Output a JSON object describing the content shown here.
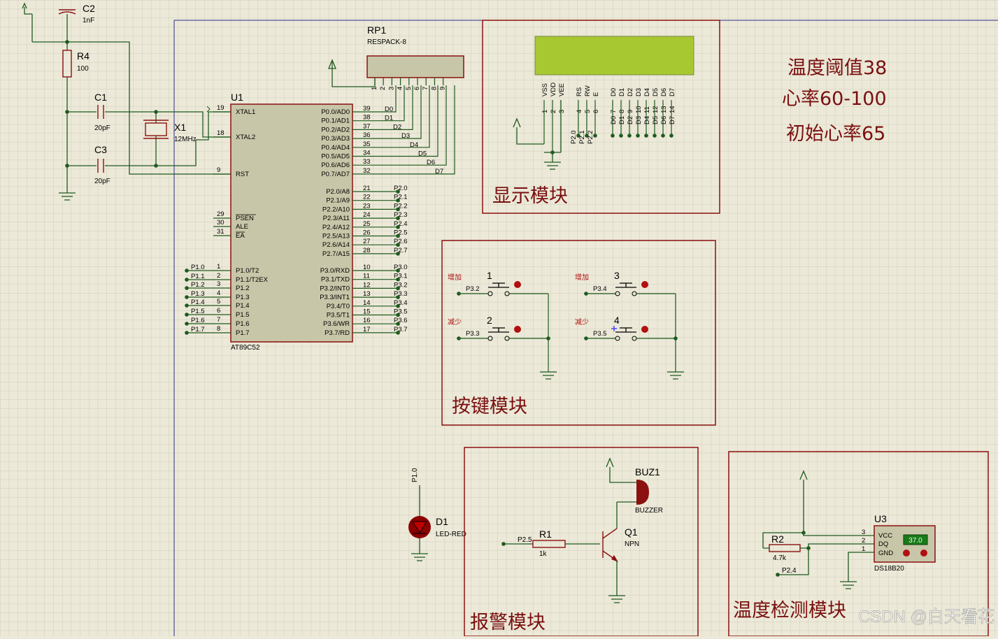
{
  "notes": {
    "threshold": "温度阈值38",
    "heart_range": "心率60-100",
    "initial_rate": "初始心率65"
  },
  "modules": {
    "display": "显示模块",
    "keys": "按键模块",
    "alarm": "报警模块",
    "temperature": "温度检测模块"
  },
  "mcu": {
    "ref": "U1",
    "part": "AT89C52",
    "left_pins": [
      {
        "num": "19",
        "label": "XTAL1"
      },
      {
        "num": "18",
        "label": "XTAL2"
      },
      {
        "num": "9",
        "label": "RST"
      },
      {
        "num": "29",
        "label": "PSEN"
      },
      {
        "num": "30",
        "label": "ALE"
      },
      {
        "num": "31",
        "label": "EA"
      },
      {
        "num": "1",
        "label": "P1.0/T2"
      },
      {
        "num": "2",
        "label": "P1.1/T2EX"
      },
      {
        "num": "3",
        "label": "P1.2"
      },
      {
        "num": "4",
        "label": "P1.3"
      },
      {
        "num": "5",
        "label": "P1.4"
      },
      {
        "num": "6",
        "label": "P1.5"
      },
      {
        "num": "7",
        "label": "P1.6"
      },
      {
        "num": "8",
        "label": "P1.7"
      }
    ],
    "p0": [
      {
        "num": "39",
        "label": "P0.0/AD0",
        "net": "D0"
      },
      {
        "num": "38",
        "label": "P0.1/AD1",
        "net": "D1"
      },
      {
        "num": "37",
        "label": "P0.2/AD2",
        "net": "D2"
      },
      {
        "num": "36",
        "label": "P0.3/AD3",
        "net": "D3"
      },
      {
        "num": "35",
        "label": "P0.4/AD4",
        "net": "D4"
      },
      {
        "num": "34",
        "label": "P0.5/AD5",
        "net": "D5"
      },
      {
        "num": "33",
        "label": "P0.6/AD6",
        "net": "D6"
      },
      {
        "num": "32",
        "label": "P0.7/AD7",
        "net": "D7"
      }
    ],
    "p2": [
      {
        "num": "21",
        "label": "P2.0/A8",
        "net": "P2.0"
      },
      {
        "num": "22",
        "label": "P2.1/A9",
        "net": "P2.1"
      },
      {
        "num": "23",
        "label": "P2.2/A10",
        "net": "P2.2"
      },
      {
        "num": "24",
        "label": "P2.3/A11",
        "net": "P2.3"
      },
      {
        "num": "25",
        "label": "P2.4/A12",
        "net": "P2.4"
      },
      {
        "num": "26",
        "label": "P2.5/A13",
        "net": "P2.5"
      },
      {
        "num": "27",
        "label": "P2.6/A14",
        "net": "P2.6"
      },
      {
        "num": "28",
        "label": "P2.7/A15",
        "net": "P2.7"
      }
    ],
    "p3": [
      {
        "num": "10",
        "label": "P3.0/RXD",
        "net": "P3.0"
      },
      {
        "num": "11",
        "label": "P3.1/TXD",
        "net": "P3.1"
      },
      {
        "num": "12",
        "label": "P3.2/INT0",
        "net": "P3.2"
      },
      {
        "num": "13",
        "label": "P3.3/INT1",
        "net": "P3.3"
      },
      {
        "num": "14",
        "label": "P3.4/T0",
        "net": "P3.4"
      },
      {
        "num": "15",
        "label": "P3.5/T1",
        "net": "P3.5"
      },
      {
        "num": "16",
        "label": "P3.6/WR",
        "net": "P3.6"
      },
      {
        "num": "17",
        "label": "P3.7/RD",
        "net": "P3.7"
      }
    ],
    "p1_nets": [
      "P1.0",
      "P1.1",
      "P1.2",
      "P1.3",
      "P1.4",
      "P1.5",
      "P1.6",
      "P1.7"
    ]
  },
  "parts": {
    "c2": {
      "ref": "C2",
      "value": "1nF"
    },
    "r4": {
      "ref": "R4",
      "value": "100"
    },
    "c1": {
      "ref": "C1",
      "value": "20pF"
    },
    "c3": {
      "ref": "C3",
      "value": "20pF"
    },
    "x1": {
      "ref": "X1",
      "value": "12MHz"
    },
    "rp1": {
      "ref": "RP1",
      "value": "RESPACK-8",
      "pins": [
        "1",
        "2",
        "3",
        "4",
        "5",
        "6",
        "7",
        "8",
        "9"
      ]
    },
    "d1": {
      "ref": "D1",
      "value": "LED-RED",
      "net": "P1.0"
    },
    "r1": {
      "ref": "R1",
      "value": "1k",
      "net": "P2.5"
    },
    "q1": {
      "ref": "Q1",
      "value": "NPN"
    },
    "buz1": {
      "ref": "BUZ1",
      "value": "BUZZER"
    },
    "r2": {
      "ref": "R2",
      "value": "4.7k",
      "net": "P2.4"
    },
    "u3": {
      "ref": "U3",
      "value": "DS18B20",
      "pins": [
        "VCC",
        "DQ",
        "GND"
      ],
      "pin_nums": [
        "3",
        "2",
        "1"
      ],
      "reading": "37.0"
    }
  },
  "lcd": {
    "pins": [
      "VSS",
      "VDD",
      "VEE",
      "RS",
      "RW",
      "E",
      "D0",
      "D1",
      "D2",
      "D3",
      "D4",
      "D5",
      "D6",
      "D7"
    ],
    "pin_nums": [
      "1",
      "2",
      "3",
      "4",
      "5",
      "6",
      "7",
      "8",
      "9",
      "10",
      "11",
      "12",
      "13",
      "14"
    ],
    "ctrl_nets": [
      "P2.0",
      "P2.1",
      "P2.2"
    ],
    "data_nets": [
      "D0",
      "D1",
      "D2",
      "D3",
      "D4",
      "D5",
      "D6",
      "D7"
    ],
    "color": "#a8c832"
  },
  "buttons": [
    {
      "ref": "1",
      "net": "P3.2",
      "label": "增加"
    },
    {
      "ref": "2",
      "net": "P3.3",
      "label": "减少"
    },
    {
      "ref": "3",
      "net": "P3.4",
      "label": "增加"
    },
    {
      "ref": "4",
      "net": "P3.5",
      "label": "减少"
    }
  ],
  "watermark": "CSDN @白天看花",
  "colors": {
    "background": "#ece9d8",
    "grid": "#cfcdbc",
    "wire": "#1e5a1e",
    "component": "#8b1111",
    "chip_fill": "#c8c6a8",
    "text_red": "#7a1010"
  }
}
